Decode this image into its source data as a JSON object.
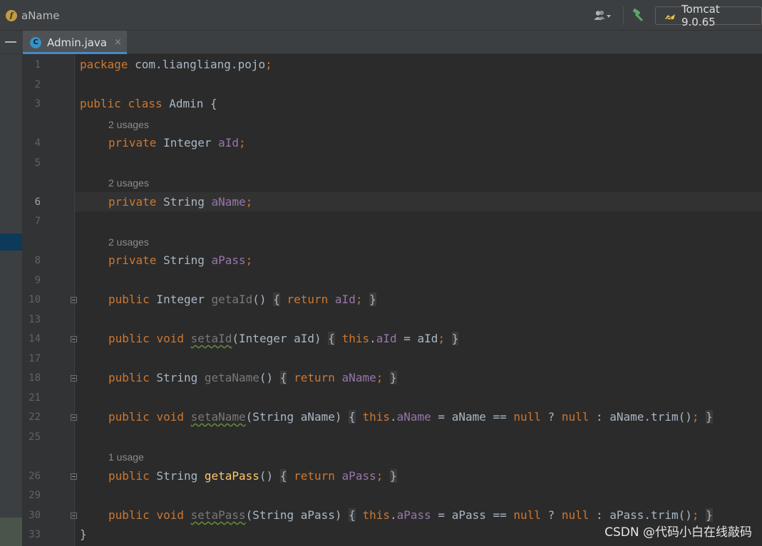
{
  "breadcrumb": {
    "icon": "f",
    "label": "aName"
  },
  "toolbar": {
    "run_config": "Tomcat 9.0.65"
  },
  "tab": {
    "icon": "C",
    "label": "Admin.java",
    "close": "×"
  },
  "watermark": "CSDN @代码小白在线敲码",
  "colors": {
    "keyword": "#cc7832",
    "field": "#9876aa",
    "method": "#ffc66d",
    "text": "#a9b7c6",
    "line_number": "#606366",
    "hint": "#8c8c8c",
    "tab_underline": "#4a88c7"
  },
  "hints": [
    "2 usages",
    "2 usages",
    "2 usages",
    "1 usage"
  ],
  "line_numbers": [
    "1",
    "2",
    "3",
    "4",
    "5",
    "6",
    "7",
    "8",
    "9",
    "10",
    "13",
    "14",
    "17",
    "18",
    "21",
    "22",
    "25",
    "26",
    "29",
    "30",
    "33"
  ],
  "current_line": "6",
  "code": {
    "l1": {
      "kw": "package",
      "rest": " com.liangliang.pojo",
      "semi": ";"
    },
    "l3": {
      "kw1": "public",
      "kw2": "class",
      "name": " Admin ",
      "brace": "{"
    },
    "l4": {
      "kw": "private",
      "type": " Integer ",
      "field": "aId",
      "semi": ";"
    },
    "l6": {
      "kw": "private",
      "type": " String ",
      "field": "aName",
      "semi": ";"
    },
    "l8": {
      "kw": "private",
      "type": " String ",
      "field": "aPass",
      "semi": ";"
    },
    "l10": {
      "kw": "public",
      "type": " Integer ",
      "method": "getaId",
      "parens": "()",
      "open": "{",
      "ret": "return",
      "field": "aId",
      "semi": ";",
      "close": "}"
    },
    "l14": {
      "kw1": "public",
      "kw2": "void",
      "method": "setaId",
      "params": "(Integer aId)",
      "open": "{",
      "this": "this",
      "dot": ".",
      "field": "aId",
      "assign": " = aId",
      "semi": ";",
      "close": "}"
    },
    "l18": {
      "kw": "public",
      "type": " String ",
      "method": "getaName",
      "parens": "()",
      "open": "{",
      "ret": "return",
      "field": "aName",
      "semi": ";",
      "close": "}"
    },
    "l22": {
      "kw1": "public",
      "kw2": "void",
      "method": "setaName",
      "params": "(String aName)",
      "open": "{",
      "this": "this",
      "dot": ".",
      "field": "aName",
      "expr1": " = aName == ",
      "null1": "null",
      "q": " ? ",
      "null2": "null",
      "expr2": " : aName.trim()",
      "semi": ";",
      "close": "}"
    },
    "l26": {
      "kw": "public",
      "type": " String ",
      "method": "getaPass",
      "parens": "()",
      "open": "{",
      "ret": "return",
      "field": "aPass",
      "semi": ";",
      "close": "}"
    },
    "l30": {
      "kw1": "public",
      "kw2": "void",
      "method": "setaPass",
      "params": "(String aPass)",
      "open": "{",
      "this": "this",
      "dot": ".",
      "field": "aPass",
      "expr1": " = aPass == ",
      "null1": "null",
      "q": " ? ",
      "null2": "null",
      "expr2": " : aPass.trim()",
      "semi": ";",
      "close": "}"
    },
    "l33": {
      "close": "}"
    }
  }
}
